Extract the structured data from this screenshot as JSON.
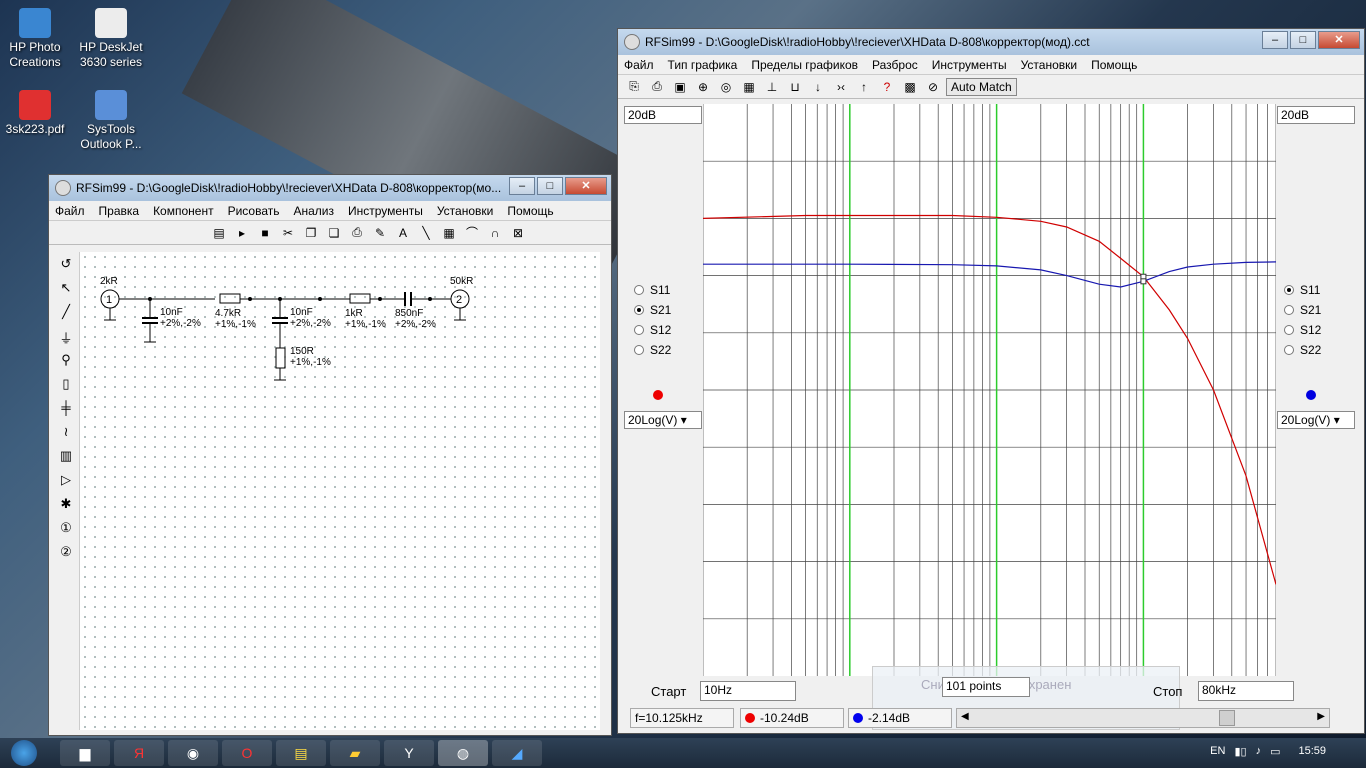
{
  "desktop": {
    "icons": [
      {
        "label": "HP Photo Creations",
        "x": 0,
        "y": 8
      },
      {
        "label": "HP DeskJet 3630 series",
        "x": 76,
        "y": 8
      },
      {
        "label": "3sk223.pdf",
        "x": 0,
        "y": 90
      },
      {
        "label": "SysTools Outlook P...",
        "x": 76,
        "y": 90
      }
    ]
  },
  "small_window": {
    "title": "RFSim99 - D:\\GoogleDisk\\!radioHobby\\!reciever\\XHData D-808\\корректор(мо...",
    "menu": [
      "Файл",
      "Правка",
      "Компонент",
      "Рисовать",
      "Анализ",
      "Инструменты",
      "Установки",
      "Помощь"
    ],
    "components": {
      "src": "2kR",
      "load": "50kR",
      "c1": "10nF",
      "c1tol": "+2%,-2%",
      "r1": "4.7kR",
      "r1tol": "+1%,-1%",
      "c2": "10nF",
      "c2tol": "+2%,-2%",
      "r2": "1kR",
      "r2tol": "+1%,-1%",
      "c3": "850nF",
      "c3tol": "+2%,-2%",
      "r3": "150R",
      "r3tol": "+1%,-1%",
      "port1": "1",
      "port2": "2"
    }
  },
  "main_window": {
    "title": "RFSim99 - D:\\GoogleDisk\\!radioHobby\\!reciever\\XHData D-808\\корректор(мод).cct",
    "menu": [
      "Файл",
      "Тип графика",
      "Пределы графиков",
      "Разброс",
      "Инструменты",
      "Установки",
      "Помощь"
    ],
    "auto_match": "Auto Match",
    "left_scale": "20dB",
    "right_scale": "20dB",
    "left_params": [
      "S11",
      "S21",
      "S12",
      "S22"
    ],
    "left_selected": "S21",
    "right_params": [
      "S11",
      "S21",
      "S12",
      "S22"
    ],
    "right_selected": "S11",
    "left_mode": "20Log(V)",
    "right_mode": "20Log(V)",
    "start_label": "Старт",
    "start_value": "10Hz",
    "points": "101 points",
    "stop_label": "Стоп",
    "stop_value": "80kHz",
    "freq_readout": "f=10.125kHz",
    "red_readout": "-10.24dB",
    "blue_readout": "-2.14dB",
    "red_color": "#d00000",
    "blue_color": "#0000cc",
    "notice": "Снимок экрана сохранен"
  },
  "chart_data": {
    "type": "line",
    "x_scale": "log",
    "xlim_hz": [
      10,
      80000
    ],
    "y_range_db": [
      -80,
      20
    ],
    "series": [
      {
        "color": "#d00000",
        "x": [
          10,
          50,
          100,
          500,
          1000,
          2000,
          3000,
          5000,
          7000,
          10000,
          15000,
          20000,
          30000,
          50000,
          80000
        ],
        "y": [
          0,
          0.5,
          0.5,
          0.5,
          0.2,
          -0.5,
          -1.5,
          -4,
          -7,
          -10.2,
          -16,
          -21,
          -30,
          -45,
          -64
        ]
      },
      {
        "color": "#1818b0",
        "x": [
          10,
          100,
          500,
          1000,
          2000,
          3000,
          5000,
          7000,
          10000,
          15000,
          20000,
          30000,
          50000,
          80000
        ],
        "y": [
          -8,
          -8,
          -8.1,
          -8.3,
          -9,
          -10,
          -11.5,
          -12,
          -11,
          -9.3,
          -8.5,
          -8,
          -7.7,
          -7.6
        ]
      }
    ],
    "markers": [
      {
        "x": 10000,
        "y": -10.2
      },
      {
        "x": 10000,
        "y": -11
      }
    ],
    "green_lines_hz": [
      100,
      1000,
      10000
    ]
  },
  "taskbar": {
    "lang": "EN",
    "time": "15:59"
  }
}
